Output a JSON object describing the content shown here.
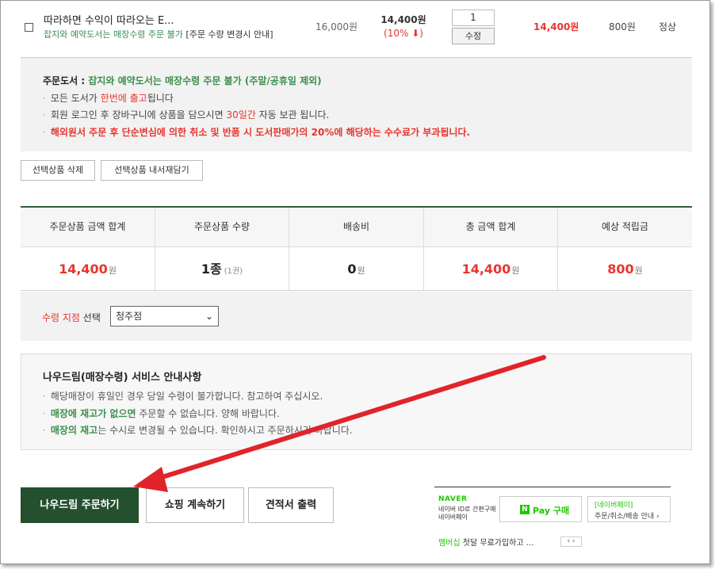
{
  "product": {
    "title": "따라하면 수익이 따라오는 E...",
    "note_green": "잡지와 예약도서는 매장수령 주문 불가",
    "note_dark": "[주문 수량 변경시 안내]",
    "list_price": "16,000원",
    "sale_price": "14,400원",
    "discount": "(10% ⬇)",
    "quantity": "1",
    "modify_label": "수정",
    "total": "14,400원",
    "points": "800원",
    "status": "정상"
  },
  "notice": {
    "title_prefix": "주문도서 : ",
    "title_green": "잡지와 예약도서는 매장수령 주문 불가 (주말/공휴일 제외)",
    "line1_a": "모든 도서가 ",
    "line1_red": "한번에 출고",
    "line1_b": "됩니다",
    "line2_a": "회원 로그인 후 장바구니에 상품을 담으시면 ",
    "line2_red": "30일간",
    "line2_b": " 자동 보관 됩니다.",
    "line3": "해외원서 주문 후 단순변심에 의한 취소 및 반품 시 도서판매가의 20%에 해당하는 수수료가 부과됩니다."
  },
  "selection_buttons": {
    "delete": "선택상품 삭제",
    "save_later": "선택상품 내서재담기"
  },
  "summary": {
    "headers": [
      "주문상품 금액 합계",
      "주문상품 수량",
      "배송비",
      "총 금액 합계",
      "예상 적립금"
    ],
    "product_total": "14,400",
    "product_total_unit": "원",
    "quantity": "1종",
    "quantity_sub": "(1권)",
    "shipping": "0",
    "shipping_unit": "원",
    "grand_total": "14,400",
    "grand_total_unit": "원",
    "points": "800",
    "points_unit": "원"
  },
  "pickup": {
    "label_red": "수령 지점",
    "label_rest": " 선택",
    "selected_store": "청주점"
  },
  "service_notice": {
    "title": "나우드림(매장수령) 서비스 안내사항",
    "line1": "해당매장이 휴일인 경우 당일 수령이 불가합니다. 참고하여 주십시오.",
    "line2_green": "매장에 재고가 없으면",
    "line2_rest": " 주문할 수 없습니다. 양해 바랍니다.",
    "line3_green": "매장의 재고",
    "line3_rest": "는 수시로 변경될 수 있습니다. 확인하시고 주문하시기 바랍니다."
  },
  "actions": {
    "order": "나우드림 주문하기",
    "continue_shopping": "쇼핑 계속하기",
    "print_quote": "견적서 출력"
  },
  "naver_pay": {
    "brand": "NAVER",
    "sub_line1": "네이버 ID로 간편구매",
    "sub_line2": "네이버페이",
    "n_mark": "N",
    "pay_button": "Pay 구매",
    "info_line1": "[네이버페이]",
    "info_line2": "주문/취소/배송 안내 ›",
    "member_green": "멤버십",
    "member_rest": " 첫달 무료가입하고 ...",
    "nav": "‹ ›"
  },
  "colors": {
    "accent_green": "#24502f",
    "green_text": "#3b8f4d",
    "price_red": "#e8352e",
    "arrow_red": "#e0242a",
    "naver_green": "#1ec800"
  }
}
